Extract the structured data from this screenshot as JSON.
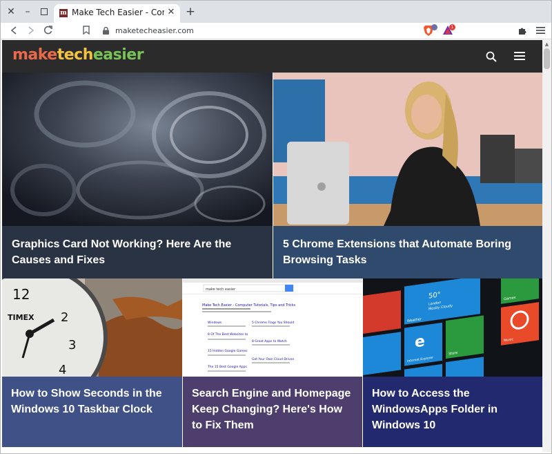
{
  "browser": {
    "tab_title": "Make Tech Easier - Comput",
    "tab_favicon": "m",
    "url": "maketecheasier.com",
    "shields_count": "",
    "rewards_count": "1"
  },
  "site": {
    "logo": {
      "part1": "make",
      "part2": "tech",
      "part3": "easier"
    }
  },
  "articles": [
    {
      "title": "Graphics Card Not Working? Here Are the Causes and Fixes",
      "caption_color": "#2a3344"
    },
    {
      "title": "5 Chrome Extensions that Automate Boring Browsing Tasks",
      "caption_color": "#2f4a6c"
    },
    {
      "title": "How to Show Seconds in the Windows 10 Taskbar Clock",
      "caption_color": "#3f5186"
    },
    {
      "title": "Search Engine and Homepage Keep Changing? Here's How to Fix Them",
      "caption_color": "#4e3e6e"
    },
    {
      "title": "How to Access the WindowsApps Folder in Windows 10",
      "caption_color": "#23296e"
    }
  ],
  "search_thumbnail": {
    "query": "make tech easier",
    "result_title": "Make Tech Easier - Computer Tutorials, Tips and Tricks",
    "links": [
      "Windows",
      "8 Of The Best Websites to Download Subtitles for Your Movies",
      "15 Hidden Google Games You Need to Play",
      "The 15 Best Google Apps for Android",
      "5 Chrome Flags You Should Enable to Boost Your Browsing",
      "8 Great Apps to Watch Videos Online With Friends in Real Time",
      "Get Your Own Cloud-Driven Operating System with ForkOS"
    ]
  },
  "windows_tiles": {
    "weather_temp": "50°",
    "weather_city": "London",
    "weather_desc": "Mostly Cloudy",
    "tiles": [
      "Weather",
      "Games",
      "Internet Explorer",
      "Store",
      "Music"
    ]
  },
  "clock_brand": "TIMEX",
  "clock_number": "12"
}
